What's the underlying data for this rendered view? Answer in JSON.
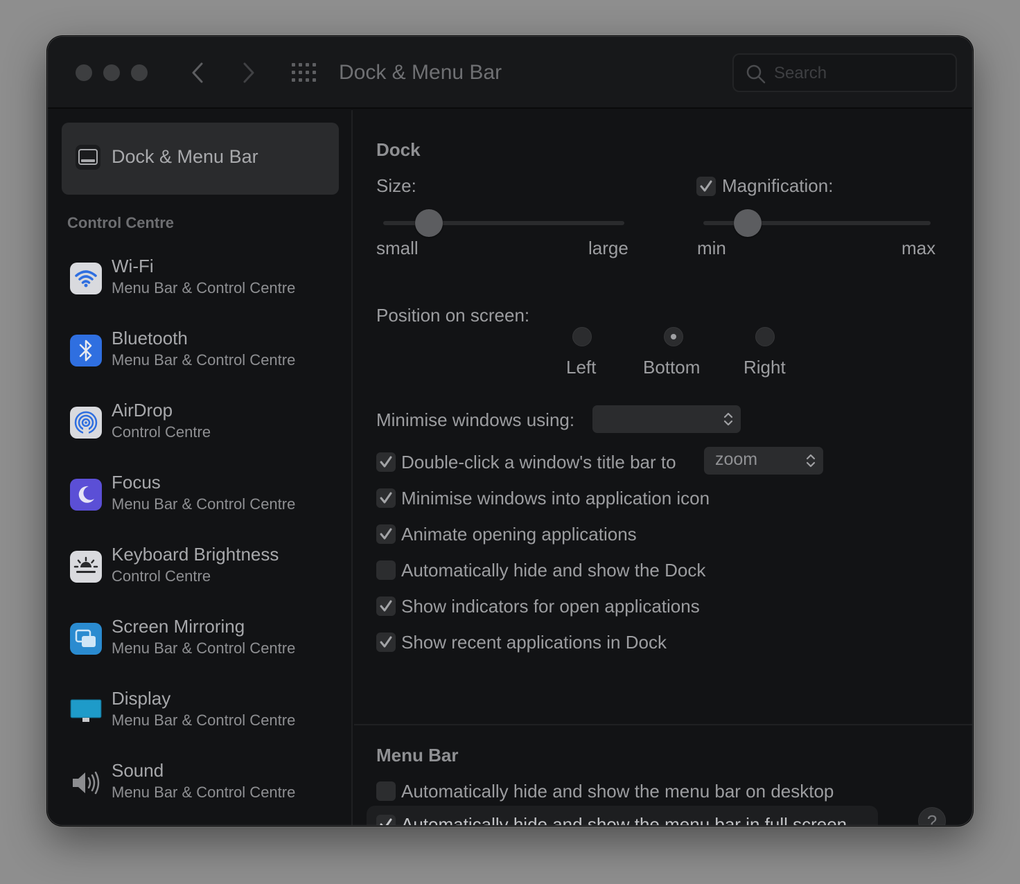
{
  "window": {
    "title": "Dock & Menu Bar",
    "search_placeholder": "Search"
  },
  "sidebar": {
    "selected": {
      "label": "Dock & Menu Bar",
      "icon": "dock-menubar-icon"
    },
    "section_title": "Control Centre",
    "items": [
      {
        "title": "Wi-Fi",
        "subtitle": "Menu Bar & Control Centre",
        "icon": "wifi-icon"
      },
      {
        "title": "Bluetooth",
        "subtitle": "Menu Bar & Control Centre",
        "icon": "bluetooth-icon"
      },
      {
        "title": "AirDrop",
        "subtitle": "Control Centre",
        "icon": "airdrop-icon"
      },
      {
        "title": "Focus",
        "subtitle": "Menu Bar & Control Centre",
        "icon": "moon-icon"
      },
      {
        "title": "Keyboard Brightness",
        "subtitle": "Control Centre",
        "icon": "keyboard-brightness-icon"
      },
      {
        "title": "Screen Mirroring",
        "subtitle": "Menu Bar & Control Centre",
        "icon": "screen-mirroring-icon"
      },
      {
        "title": "Display",
        "subtitle": "Menu Bar & Control Centre",
        "icon": "display-icon"
      },
      {
        "title": "Sound",
        "subtitle": "Menu Bar & Control Centre",
        "icon": "speaker-icon"
      }
    ]
  },
  "dock": {
    "section_title": "Dock",
    "size_label": "Size:",
    "size_min_label": "small",
    "size_max_label": "large",
    "size_value_fraction": 0.19,
    "magnification_label": "Magnification:",
    "magnification_checked": true,
    "mag_min_label": "min",
    "mag_max_label": "max",
    "mag_value_fraction": 0.19,
    "position_label": "Position on screen:",
    "position_options": [
      "Left",
      "Bottom",
      "Right"
    ],
    "position_selected": "Bottom",
    "minimise_label": "Minimise windows using:",
    "minimise_value": "",
    "double_click_label": "Double-click a window's title bar to",
    "double_click_checked": true,
    "double_click_value": "zoom",
    "options": [
      {
        "label": "Minimise windows into application icon",
        "checked": true
      },
      {
        "label": "Animate opening applications",
        "checked": true
      },
      {
        "label": "Automatically hide and show the Dock",
        "checked": false
      },
      {
        "label": "Show indicators for open applications",
        "checked": true
      },
      {
        "label": "Show recent applications in Dock",
        "checked": true
      }
    ]
  },
  "menu_bar": {
    "section_title": "Menu Bar",
    "options": [
      {
        "label": "Automatically hide and show the menu bar on desktop",
        "checked": false
      },
      {
        "label": "Automatically hide and show the menu bar in full screen",
        "checked": true
      }
    ],
    "help_label": "?"
  },
  "colors": {
    "window_bg": "#121315",
    "selected_bg": "#2a2b2d",
    "wifi": "#e6e7ea",
    "bluetooth": "#2f6fe0",
    "focus": "#5b4fd6",
    "mirroring": "#2a8bd0",
    "display": "#1e9bc9"
  }
}
